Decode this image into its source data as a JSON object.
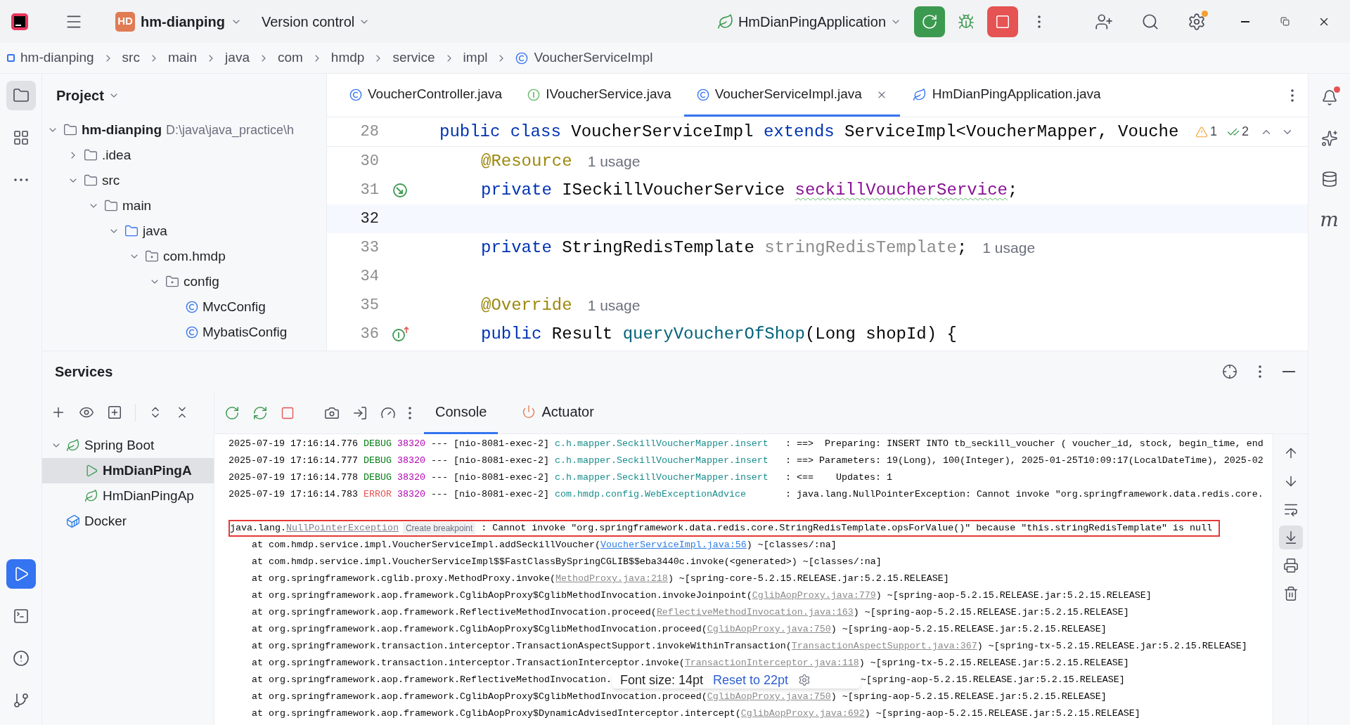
{
  "title_bar": {
    "project_badge": "HD",
    "project": "hm-dianping",
    "vcs": "Version control",
    "run_config": "HmDianPingApplication"
  },
  "breadcrumb": [
    {
      "label": "hm-dianping",
      "kind": "module"
    },
    {
      "label": "src",
      "kind": "dir"
    },
    {
      "label": "main",
      "kind": "dir"
    },
    {
      "label": "java",
      "kind": "dir"
    },
    {
      "label": "com",
      "kind": "dir"
    },
    {
      "label": "hmdp",
      "kind": "dir"
    },
    {
      "label": "service",
      "kind": "dir"
    },
    {
      "label": "impl",
      "kind": "dir"
    },
    {
      "label": "VoucherServiceImpl",
      "kind": "class"
    }
  ],
  "left_strip": {
    "top": [
      {
        "kind": "project",
        "selected": true
      },
      {
        "kind": "structure",
        "selected": false
      },
      {
        "kind": "more",
        "selected": false
      }
    ],
    "bottom": [
      {
        "kind": "services",
        "selected": true
      },
      {
        "kind": "terminal",
        "selected": false
      },
      {
        "kind": "problems",
        "selected": false
      },
      {
        "kind": "git",
        "selected": false
      }
    ]
  },
  "project_panel": {
    "title": "Project",
    "tree": [
      {
        "label": "hm-dianping",
        "kind": "module",
        "path": "D:\\java\\java_practice\\h",
        "expanded": true,
        "children": [
          {
            "label": ".idea",
            "kind": "folder",
            "expanded": false
          },
          {
            "label": "src",
            "kind": "folder",
            "expanded": true,
            "children": [
              {
                "label": "main",
                "kind": "folder",
                "expanded": true,
                "children": [
                  {
                    "label": "java",
                    "kind": "source_root",
                    "expanded": true,
                    "children": [
                      {
                        "label": "com.hmdp",
                        "kind": "package",
                        "expanded": true,
                        "children": [
                          {
                            "label": "config",
                            "kind": "package",
                            "expanded": true,
                            "children": [
                              {
                                "label": "MvcConfig",
                                "kind": "class"
                              },
                              {
                                "label": "MybatisConfig",
                                "kind": "class"
                              }
                            ]
                          }
                        ]
                      }
                    ]
                  }
                ]
              }
            ]
          }
        ]
      }
    ]
  },
  "editor": {
    "tabs": [
      {
        "label": "VoucherController.java",
        "kind": "class",
        "selected": false
      },
      {
        "label": "IVoucherService.java",
        "kind": "interface",
        "selected": false
      },
      {
        "label": "VoucherServiceImpl.java",
        "kind": "class",
        "selected": true
      },
      {
        "label": "HmDianPingApplication.java",
        "kind": "app",
        "selected": false
      }
    ],
    "sticky_line": {
      "number": "28",
      "code": [
        {
          "text": "public class ",
          "kind": "keyword"
        },
        {
          "text": "VoucherServiceImpl ",
          "kind": "plain"
        },
        {
          "text": "extends ",
          "kind": "keyword"
        },
        {
          "text": "ServiceImpl<VoucherMapper, Vouche",
          "kind": "plain"
        }
      ]
    },
    "inspections": {
      "warnings": "1",
      "passed": "2"
    },
    "lines": [
      {
        "number": "30",
        "current": false,
        "code": [
          {
            "text": "@Resource",
            "kind": "annotation"
          }
        ],
        "hint": "1 usage"
      },
      {
        "number": "31",
        "current": false,
        "gutter": {
          "kind": "injection"
        },
        "code": [
          {
            "text": "private ",
            "kind": "keyword"
          },
          {
            "text": "ISeckillVoucherService ",
            "kind": "plain"
          },
          {
            "text": "seckillVoucherService",
            "kind": "field_typo"
          },
          {
            "text": ";",
            "kind": "plain"
          }
        ]
      },
      {
        "number": "32",
        "current": true
      },
      {
        "number": "33",
        "current": false,
        "code": [
          {
            "text": "private ",
            "kind": "keyword"
          },
          {
            "text": "StringRedisTemplate ",
            "kind": "plain"
          },
          {
            "text": "stringRedisTemplate",
            "kind": "unused"
          },
          {
            "text": ";",
            "kind": "plain"
          }
        ],
        "hint": "1 usage"
      },
      {
        "number": "34",
        "current": false
      },
      {
        "number": "35",
        "current": false,
        "code": [
          {
            "text": "@Override",
            "kind": "annotation"
          }
        ],
        "hint": "1 usage"
      },
      {
        "number": "36",
        "current": false,
        "gutter": {
          "kind": "implements"
        },
        "code": [
          {
            "text": "public ",
            "kind": "keyword"
          },
          {
            "text": "Result ",
            "kind": "plain"
          },
          {
            "text": "queryVoucherOfShop",
            "kind": "method"
          },
          {
            "text": "(Long shopId) {",
            "kind": "plain"
          }
        ]
      }
    ]
  },
  "right_strip": [
    {
      "kind": "notifications",
      "badge": true
    },
    {
      "kind": "assistant",
      "badge": false
    },
    {
      "kind": "database",
      "badge": false
    },
    {
      "kind": "mybatis",
      "label": "m",
      "badge": false
    }
  ],
  "services": {
    "title": "Services",
    "tree": [
      {
        "label": "Spring Boot",
        "kind": "spring",
        "expanded": true,
        "selected": false,
        "children": [
          {
            "label": "HmDianPingA",
            "kind": "running",
            "selected": true
          },
          {
            "label": "HmDianPingAp",
            "kind": "app",
            "selected": false
          }
        ]
      },
      {
        "label": "Docker",
        "kind": "docker",
        "selected": false
      }
    ],
    "console_tabs": [
      {
        "label": "Console",
        "kind": "console",
        "selected": true
      },
      {
        "label": "Actuator",
        "kind": "actuator",
        "selected": false
      }
    ],
    "log": [
      {
        "time": "2025-07-19 17:16:14.776",
        "level": "DEBUG",
        "pid": "38320",
        "thread": "--- [nio-8081-exec-2]",
        "logger": "c.h.mapper.SeckillVoucherMapper.insert",
        "message": ": ==>  Preparing: INSERT INTO tb_seckill_voucher ( voucher_id, stock, begin_time, end"
      },
      {
        "time": "2025-07-19 17:16:14.777",
        "level": "DEBUG",
        "pid": "38320",
        "thread": "--- [nio-8081-exec-2]",
        "logger": "c.h.mapper.SeckillVoucherMapper.insert",
        "message": ": ==> Parameters: 19(Long), 100(Integer), 2025-01-25T10:09:17(LocalDateTime), 2025-02"
      },
      {
        "time": "2025-07-19 17:16:14.778",
        "level": "DEBUG",
        "pid": "38320",
        "thread": "--- [nio-8081-exec-2]",
        "logger": "c.h.mapper.SeckillVoucherMapper.insert",
        "message": ": <==    Updates: 1"
      },
      {
        "time": "2025-07-19 17:16:14.783",
        "level": "ERROR",
        "pid": "38320",
        "thread": "--- [nio-8081-exec-2]",
        "logger": "com.hmdp.config.WebExceptionAdvice",
        "message": ": java.lang.NullPointerException: Cannot invoke \"org.springframework.data.redis.core."
      }
    ],
    "exception": {
      "prefix": "java.lang.",
      "link": "NullPointerException",
      "action": "Create breakpoint",
      "message": ": Cannot invoke \"org.springframework.data.redis.core.StringRedisTemplate.opsForValue()\" because \"this.stringRedisTemplate\" is null"
    },
    "trace": [
      {
        "before": "at com.hmdp.service.impl.VoucherServiceImpl.addSeckillVoucher(",
        "link": {
          "text": "VoucherServiceImpl.java:56",
          "kind": "source"
        },
        "after": ") ~[classes/:na]"
      },
      {
        "before": "at com.hmdp.service.impl.VoucherServiceImpl$$FastClassBySpringCGLIB$$eba3440c.invoke(<generated>) ~[classes/:na]"
      },
      {
        "before": "at org.springframework.cglib.proxy.MethodProxy.invoke(",
        "link": {
          "text": "MethodProxy.java:218",
          "kind": "library"
        },
        "after": ") ~[spring-core-5.2.15.RELEASE.jar:5.2.15.RELEASE]"
      },
      {
        "before": "at org.springframework.aop.framework.CglibAopProxy$CglibMethodInvocation.invokeJoinpoint(",
        "link": {
          "text": "CglibAopProxy.java:779",
          "kind": "library"
        },
        "after": ") ~[spring-aop-5.2.15.RELEASE.jar:5.2.15.RELEASE]"
      },
      {
        "before": "at org.springframework.aop.framework.ReflectiveMethodInvocation.proceed(",
        "link": {
          "text": "ReflectiveMethodInvocation.java:163",
          "kind": "library"
        },
        "after": ") ~[spring-aop-5.2.15.RELEASE.jar:5.2.15.RELEASE]"
      },
      {
        "before": "at org.springframework.aop.framework.CglibAopProxy$CglibMethodInvocation.proceed(",
        "link": {
          "text": "CglibAopProxy.java:750",
          "kind": "library"
        },
        "after": ") ~[spring-aop-5.2.15.RELEASE.jar:5.2.15.RELEASE]"
      },
      {
        "before": "at org.springframework.transaction.interceptor.TransactionAspectSupport.invokeWithinTransaction(",
        "link": {
          "text": "TransactionAspectSupport.java:367",
          "kind": "library"
        },
        "after": ") ~[spring-tx-5.2.15.RELEASE.jar:5.2.15.RELEASE]"
      },
      {
        "before": "at org.springframework.transaction.interceptor.TransactionInterceptor.invoke(",
        "link": {
          "text": "TransactionInterceptor.java:118",
          "kind": "library"
        },
        "after": ") ~[spring-tx-5.2.15.RELEASE.jar:5.2.15.RELEASE]"
      },
      {
        "before": "at org.springframework.aop.framework.ReflectiveMethodInvocation.",
        "popup": true,
        "after": "~[spring-aop-5.2.15.RELEASE.jar:5.2.15.RELEASE]"
      },
      {
        "before": "at org.springframework.aop.framework.CglibAopProxy$CglibMethodInvocation.proceed(",
        "link": {
          "text": "CglibAopProxy.java:750",
          "kind": "library"
        },
        "after": ") ~[spring-aop-5.2.15.RELEASE.jar:5.2.15.RELEASE]"
      },
      {
        "before": "at org.springframework.aop.framework.CglibAopProxy$DynamicAdvisedInterceptor.intercept(",
        "link": {
          "text": "CglibAopProxy.java:692",
          "kind": "library"
        },
        "after": ") ~[spring-aop-5.2.15.RELEASE.jar:5.2.15.RELEASE]"
      }
    ],
    "font_popup": {
      "label": "Font size: 14pt",
      "action": "Reset to 22pt"
    },
    "console_tools": [
      {
        "kind": "up",
        "selected": false
      },
      {
        "kind": "down",
        "selected": false
      },
      {
        "kind": "wrap",
        "selected": false
      },
      {
        "kind": "scroll_end",
        "selected": true
      },
      {
        "kind": "print",
        "selected": false
      },
      {
        "kind": "clear",
        "selected": false
      }
    ]
  }
}
